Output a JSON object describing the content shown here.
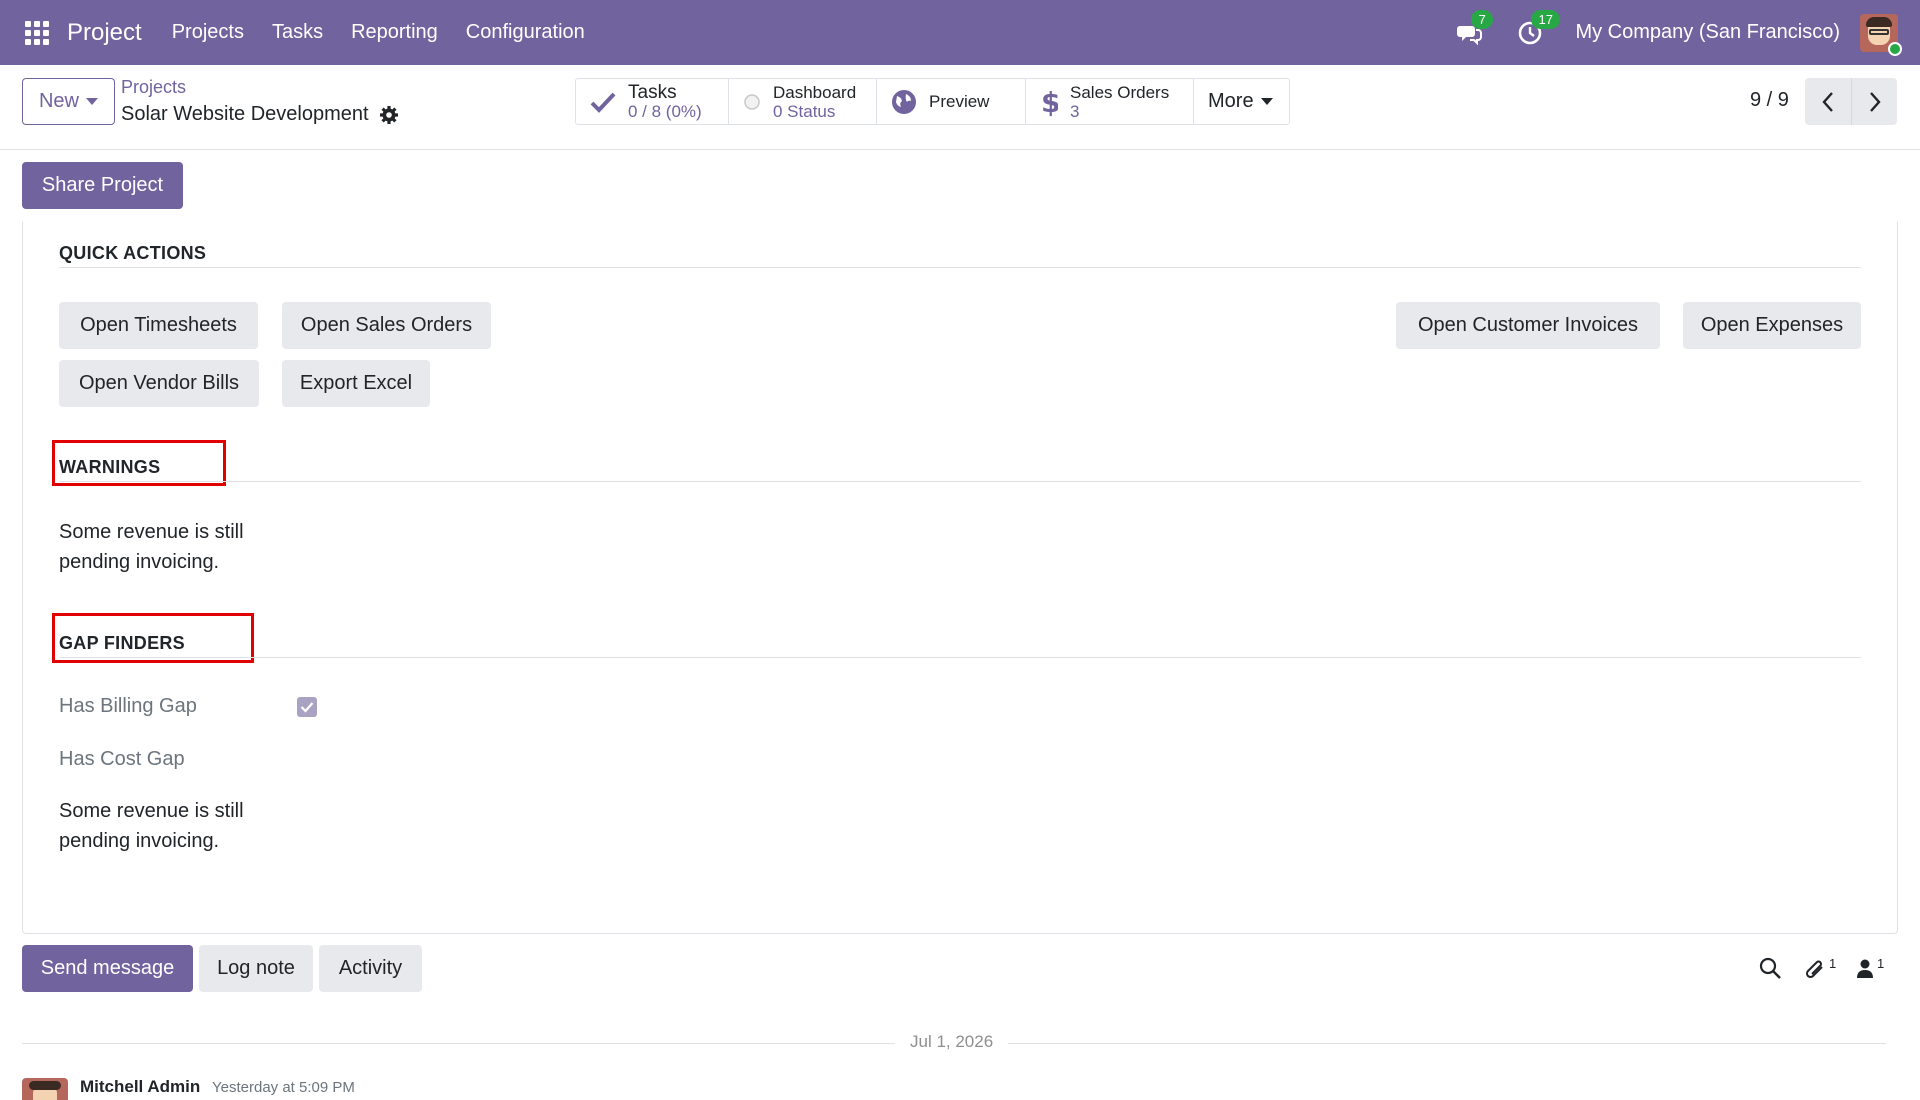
{
  "navbar": {
    "app_name": "Project",
    "menu": [
      "Projects",
      "Tasks",
      "Reporting",
      "Configuration"
    ],
    "messages_count": "7",
    "activities_count": "17",
    "company": "My Company (San Francisco)"
  },
  "control": {
    "new_label": "New",
    "breadcrumb": "Projects",
    "record_name": "Solar Website Development",
    "stats": {
      "tasks_label": "Tasks",
      "tasks_value": "0 / 8 (0%)",
      "dashboard_label": "Dashboard",
      "dashboard_value": "0 Status",
      "preview_label": "Preview",
      "sales_label": "Sales Orders",
      "sales_value": "3",
      "more_label": "More"
    },
    "pager": "9 / 9"
  },
  "sheet": {
    "share_label": "Share Project",
    "quick_actions": {
      "title": "QUICK ACTIONS",
      "buttons": {
        "timesheets": "Open Timesheets",
        "sales_orders": "Open Sales Orders",
        "customer_invoices": "Open Customer Invoices",
        "expenses": "Open Expenses",
        "vendor_bills": "Open Vendor Bills",
        "export_excel": "Export Excel"
      }
    },
    "warnings": {
      "title": "WARNINGS",
      "line1": "Some revenue is still",
      "line2": "pending invoicing."
    },
    "gap_finders": {
      "title": "GAP FINDERS",
      "billing_gap_label": "Has Billing Gap",
      "billing_gap_checked": true,
      "cost_gap_label": "Has Cost Gap",
      "note_line1": "Some revenue is still",
      "note_line2": "pending invoicing."
    }
  },
  "chatter": {
    "send_label": "Send message",
    "log_label": "Log note",
    "activity_label": "Activity",
    "attachments_count": "1",
    "followers_count": "1",
    "date": "Jul 1, 2026",
    "author": "Mitchell Admin",
    "time": "Yesterday at 5:09 PM"
  },
  "colors": {
    "brand": "#71639e",
    "badge": "#28a745",
    "highlight": "#e00000"
  }
}
